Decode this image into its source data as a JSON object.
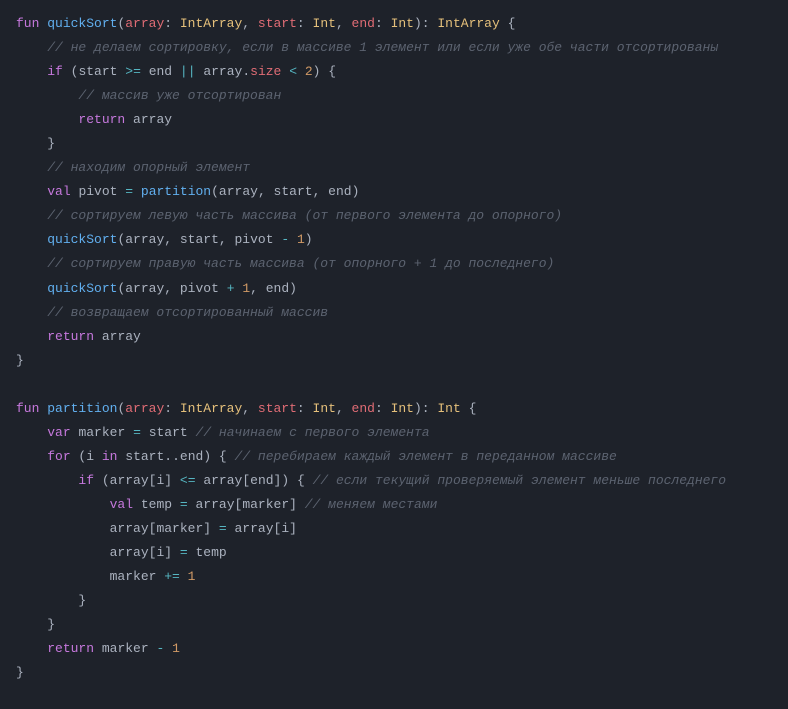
{
  "code": {
    "l1": {
      "kw_fun": "fun",
      "fn": "quickSort",
      "p1": "array",
      "t1": "IntArray",
      "p2": "start",
      "t2": "Int",
      "p3": "end",
      "t3": "Int",
      "ret": "IntArray"
    },
    "l2": {
      "cmt": "// не делаем сортировку, если в массиве 1 элемент или если уже обе части отсортированы"
    },
    "l3": {
      "kw_if": "if",
      "a": "start",
      "op1": ">=",
      "b": "end",
      "op2": "||",
      "c": "array",
      "prop": "size",
      "op3": "<",
      "num": "2"
    },
    "l4": {
      "cmt": "// массив уже отсортирован"
    },
    "l5": {
      "kw_ret": "return",
      "id": "array"
    },
    "l7": {
      "cmt": "// находим опорный элемент"
    },
    "l8": {
      "kw_val": "val",
      "id": "pivot",
      "op": "=",
      "fn": "partition",
      "a": "array",
      "b": "start",
      "c": "end"
    },
    "l9": {
      "cmt": "// сортируем левую часть массива (от первого элемента до опорного)"
    },
    "l10": {
      "fn": "quickSort",
      "a": "array",
      "b": "start",
      "c": "pivot",
      "op": "-",
      "num": "1"
    },
    "l11": {
      "cmt": "// сортируем правую часть массива (от опорного + 1 до последнего)"
    },
    "l12": {
      "fn": "quickSort",
      "a": "array",
      "b": "pivot",
      "op": "+",
      "num": "1",
      "c": "end"
    },
    "l13": {
      "cmt": "// возвращаем отсортированный массив"
    },
    "l14": {
      "kw_ret": "return",
      "id": "array"
    },
    "l17": {
      "kw_fun": "fun",
      "fn": "partition",
      "p1": "array",
      "t1": "IntArray",
      "p2": "start",
      "t2": "Int",
      "p3": "end",
      "t3": "Int",
      "ret": "Int"
    },
    "l18": {
      "kw_var": "var",
      "id": "marker",
      "op": "=",
      "val": "start",
      "cmt": "// начинаем с первого элемента"
    },
    "l19": {
      "kw_for": "for",
      "i": "i",
      "kw_in": "in",
      "a": "start",
      "b": "end",
      "cmt": "// перебираем каждый элемент в переданном массиве"
    },
    "l20": {
      "kw_if": "if",
      "a": "array",
      "i1": "i",
      "op": "<=",
      "b": "array",
      "i2": "end",
      "cmt": "// если текущий проверяемый элемент меньше последнего"
    },
    "l21": {
      "kw_val": "val",
      "id": "temp",
      "op": "=",
      "a": "array",
      "idx": "marker",
      "cmt": "// меняем местами"
    },
    "l22": {
      "a": "array",
      "idx1": "marker",
      "op": "=",
      "b": "array",
      "idx2": "i"
    },
    "l23": {
      "a": "array",
      "idx": "i",
      "op": "=",
      "b": "temp"
    },
    "l24": {
      "id": "marker",
      "op": "+=",
      "num": "1"
    },
    "l27": {
      "kw_ret": "return",
      "id": "marker",
      "op": "-",
      "num": "1"
    }
  }
}
